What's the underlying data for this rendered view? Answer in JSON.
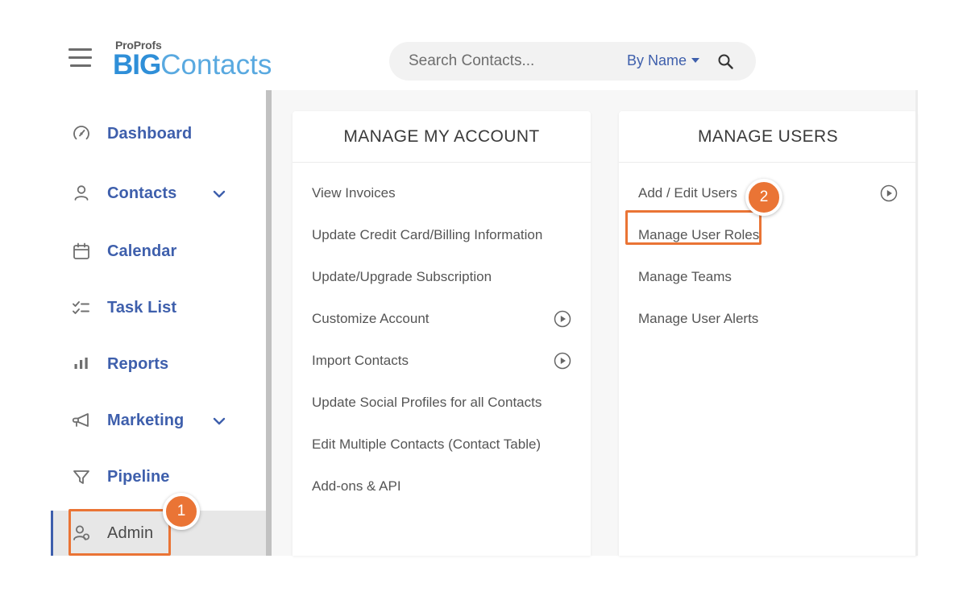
{
  "brand": {
    "pro_label": "ProProfs",
    "name_bold": "BIG",
    "name_light": "Contacts",
    "accent_blue": "#2f8fd8",
    "light_blue": "#59a9e0"
  },
  "topbar": {
    "menu_icon": "hamburger-icon",
    "search": {
      "placeholder": "Search Contacts...",
      "value": "",
      "filter_label": "By Name",
      "search_icon": "search-icon",
      "dropdown_icon": "chevron-down-icon"
    }
  },
  "sidebar": {
    "items": [
      {
        "label": "Dashboard",
        "icon": "speedometer-icon",
        "has_chevron": false,
        "active": false
      },
      {
        "label": "Contacts",
        "icon": "person-icon",
        "has_chevron": true,
        "active": false
      },
      {
        "label": "Calendar",
        "icon": "calendar-icon",
        "has_chevron": false,
        "active": false
      },
      {
        "label": "Task List",
        "icon": "checklist-icon",
        "has_chevron": false,
        "active": false
      },
      {
        "label": "Reports",
        "icon": "bar-chart-icon",
        "has_chevron": false,
        "active": false
      },
      {
        "label": "Marketing",
        "icon": "megaphone-icon",
        "has_chevron": true,
        "active": false
      },
      {
        "label": "Pipeline",
        "icon": "funnel-icon",
        "has_chevron": false,
        "active": false
      },
      {
        "label": "Admin",
        "icon": "user-admin-icon",
        "has_chevron": false,
        "active": true
      }
    ]
  },
  "panels": [
    {
      "title": "MANAGE MY ACCOUNT",
      "rows": [
        {
          "label": "View Invoices",
          "has_play": false
        },
        {
          "label": "Update Credit Card/Billing Information",
          "has_play": false
        },
        {
          "label": "Update/Upgrade Subscription",
          "has_play": false
        },
        {
          "label": "Customize Account",
          "has_play": true
        },
        {
          "label": "Import Contacts",
          "has_play": true
        },
        {
          "label": "Update Social Profiles for all Contacts",
          "has_play": false
        },
        {
          "label": "Edit Multiple Contacts (Contact Table)",
          "has_play": false
        },
        {
          "label": "Add-ons & API",
          "has_play": false
        }
      ]
    },
    {
      "title": "MANAGE USERS",
      "rows": [
        {
          "label": "Add / Edit Users",
          "has_play": true
        },
        {
          "label": "Manage User Roles",
          "has_play": false
        },
        {
          "label": "Manage Teams",
          "has_play": false
        },
        {
          "label": "Manage User Alerts",
          "has_play": false
        }
      ]
    }
  ],
  "annotations": {
    "highlight_color": "#ea7435",
    "steps": [
      {
        "number": "1",
        "target": "Admin"
      },
      {
        "number": "2",
        "target": "Manage User Roles"
      }
    ]
  }
}
